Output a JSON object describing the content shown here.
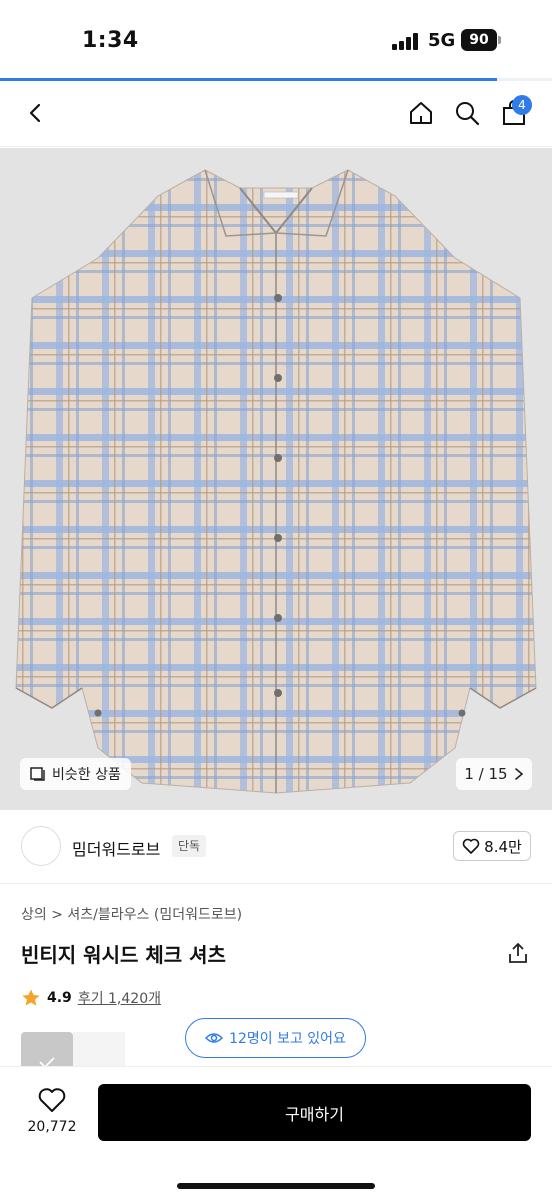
{
  "status_bar": {
    "time": "1:34",
    "network": "5G",
    "battery": "90"
  },
  "page_progress": 0.9,
  "nav": {
    "cart_count": "4"
  },
  "gallery": {
    "similar_label": "비슷한 상품",
    "counter": "1 / 15"
  },
  "shop": {
    "name": "밈더워드로브",
    "tag": "단독",
    "likes": "8.4만"
  },
  "product": {
    "breadcrumb": [
      "상의",
      "셔츠/블라우스 (밈더워드로브)"
    ],
    "title": "빈티지 워시드 체크 셔츠",
    "rating": "4.9",
    "reviews_label": "후기 1,420개"
  },
  "viewers_label": "12명이 보고 있어요",
  "bottom_bar": {
    "wish_count": "20,772",
    "buy_label": "구매하기"
  },
  "colors": {
    "accent": "#2f7be8",
    "buy_button": "#000000",
    "star": "#f2a52a"
  }
}
